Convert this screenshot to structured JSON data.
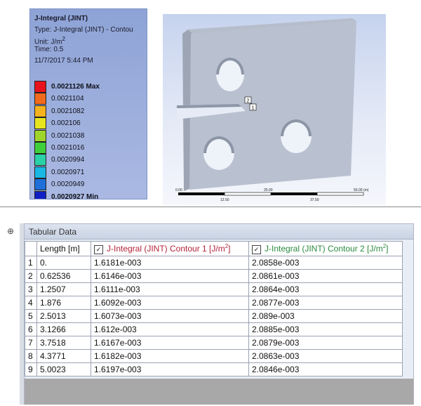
{
  "legend": {
    "title": "J-Integral (JINT)",
    "type_line": "Type: J-Integral (JINT) - Contou",
    "unit_line": "Unit: J/m",
    "unit_sup": "2",
    "time_line": "Time: 0.5",
    "date_line": "11/7/2017 5:44 PM",
    "levels": [
      {
        "label": "0.0021126 Max",
        "color": "#e8141b",
        "bold": true
      },
      {
        "label": "0.0021104",
        "color": "#f26a1c",
        "bold": false
      },
      {
        "label": "0.0021082",
        "color": "#f5b21f",
        "bold": false
      },
      {
        "label": "0.002106",
        "color": "#e6e41f",
        "bold": false
      },
      {
        "label": "0.0021038",
        "color": "#9fd52a",
        "bold": false
      },
      {
        "label": "0.0021016",
        "color": "#3fcf3a",
        "bold": false
      },
      {
        "label": "0.0020994",
        "color": "#2bd1a6",
        "bold": false
      },
      {
        "label": "0.0020971",
        "color": "#1ab7e3",
        "bold": false
      },
      {
        "label": "0.0020949",
        "color": "#1e6fd9",
        "bold": false
      },
      {
        "label": "0.0020927 Min",
        "color": "#0f1fc4",
        "bold": true
      }
    ]
  },
  "viewport": {
    "marker1": "2",
    "marker2": "1",
    "scale_top": [
      "0.00",
      "25.00",
      "50.00 (m)"
    ],
    "scale_bottom": [
      "12.50",
      "37.50"
    ]
  },
  "table": {
    "panel_title": "Tabular Data",
    "col_length": "Length [m]",
    "col_c1": "J-Integral (JINT) Contour 1 [J/m",
    "col_c2": "J-Integral (JINT) Contour 2 [J/m",
    "unit_sup": "2",
    "unit_close": "]",
    "rows": [
      {
        "i": "1",
        "len": "0.",
        "c1": "1.6181e-003",
        "c2": "2.0858e-003"
      },
      {
        "i": "2",
        "len": "0.62536",
        "c1": "1.6146e-003",
        "c2": "2.0861e-003"
      },
      {
        "i": "3",
        "len": "1.2507",
        "c1": "1.6111e-003",
        "c2": "2.0864e-003"
      },
      {
        "i": "4",
        "len": "1.876",
        "c1": "1.6092e-003",
        "c2": "2.0877e-003"
      },
      {
        "i": "5",
        "len": "2.5013",
        "c1": "1.6073e-003",
        "c2": "2.089e-003"
      },
      {
        "i": "6",
        "len": "3.1266",
        "c1": "1.612e-003",
        "c2": "2.0885e-003"
      },
      {
        "i": "7",
        "len": "3.7518",
        "c1": "1.6167e-003",
        "c2": "2.0879e-003"
      },
      {
        "i": "8",
        "len": "4.3771",
        "c1": "1.6182e-003",
        "c2": "2.0863e-003"
      },
      {
        "i": "9",
        "len": "5.0023",
        "c1": "1.6197e-003",
        "c2": "2.0846e-003"
      }
    ]
  }
}
